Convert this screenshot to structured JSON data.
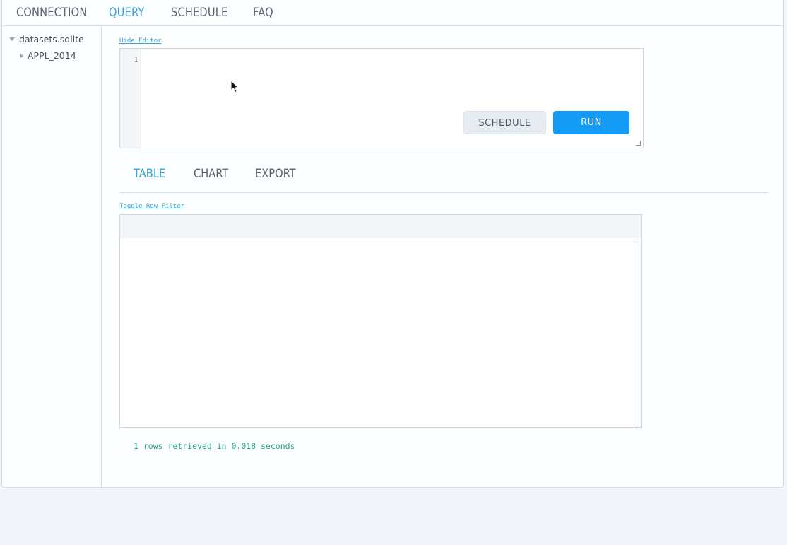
{
  "nav": {
    "tabs": [
      {
        "label": "CONNECTION",
        "active": false
      },
      {
        "label": "QUERY",
        "active": true
      },
      {
        "label": "SCHEDULE",
        "active": false
      },
      {
        "label": "FAQ",
        "active": false
      }
    ]
  },
  "sidebar": {
    "database": "datasets.sqlite",
    "tables": [
      "APPL_2014"
    ]
  },
  "editor": {
    "toggle_label": "Hide Editor",
    "line_numbers": [
      "1"
    ],
    "content": "",
    "schedule_label": "SCHEDULE",
    "run_label": "RUN"
  },
  "results": {
    "tabs": [
      {
        "label": "TABLE",
        "active": true
      },
      {
        "label": "CHART",
        "active": false
      },
      {
        "label": "EXPORT",
        "active": false
      }
    ],
    "row_filter_label": "Toggle Row Filter",
    "status": "1 rows retrieved in 0.018 seconds"
  },
  "colors": {
    "accent": "#33a3d6",
    "run_button": "#139bf5",
    "status_text": "#1aa87a"
  }
}
